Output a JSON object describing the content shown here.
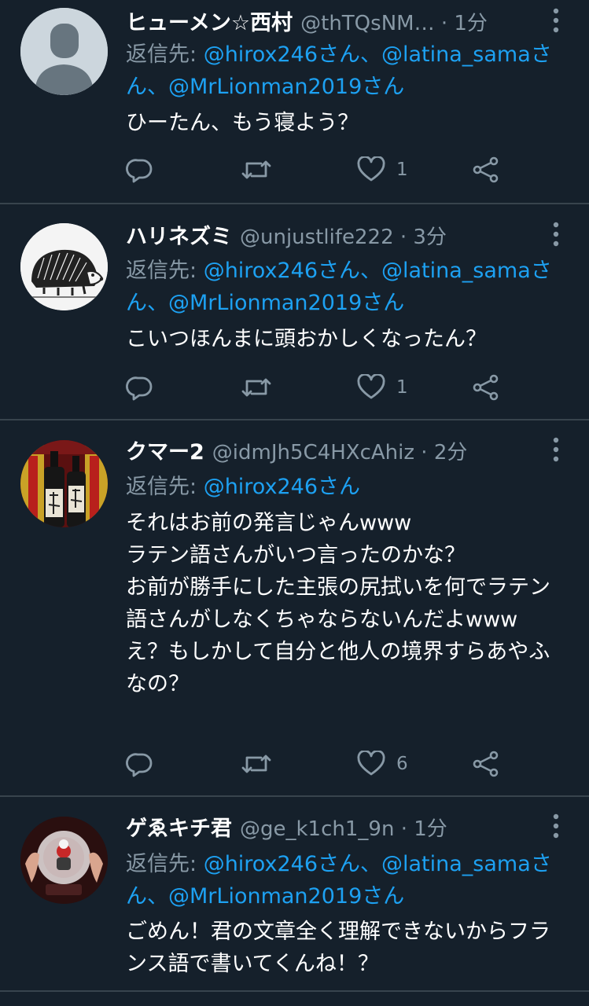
{
  "tweets": [
    {
      "name": "ヒューメン☆西村",
      "handle": "@thTQsNM…",
      "time": "1分",
      "reply_prefix": "返信先: ",
      "reply_mentions": "@hirox246さん、@latina_samaさん、@MrLionman2019さん",
      "text": "ひーたん、もう寝よう？",
      "likes": "1",
      "avatar": "default-avatar"
    },
    {
      "name": "ハリネズミ",
      "handle": "@unjustlife222",
      "time": "3分",
      "reply_prefix": "返信先: ",
      "reply_mentions": "@hirox246さん、@latina_samaさん、@MrLionman2019さん",
      "text": "こいつほんまに頭おかしくなったん？",
      "likes": "1",
      "avatar": "hedgehog-avatar"
    },
    {
      "name": "クマー2",
      "handle": "@idmJh5C4HXcAhiz",
      "time": "2分",
      "reply_prefix": "返信先: ",
      "reply_mentions": "@hirox246さん",
      "text": "それはお前の発言じゃんwww\nラテン語さんがいつ言ったのかな？\nお前が勝手にした主張の尻拭いを何でラテン語さんがしなくちゃならないんだよwww\nえ？もしかして自分と他人の境界すらあやふなの？",
      "likes": "6",
      "avatar": "sake-bottles-avatar"
    },
    {
      "name": "ゲゑキチ君",
      "handle": "@ge_k1ch1_9n",
      "time": "1分",
      "reply_prefix": "返信先: ",
      "reply_mentions": "@hirox246さん、@latina_samaさん、@MrLionman2019さん",
      "text": "ごめん！君の文章全く理解できないからフランス語で書いてくんね！？",
      "likes": "",
      "avatar": "crystal-ball-avatar"
    }
  ],
  "separator": " · ",
  "colors": {
    "background": "#15202b",
    "divider": "#38444d",
    "text": "#ffffff",
    "secondary": "#8899a6",
    "link": "#1da1f2"
  }
}
